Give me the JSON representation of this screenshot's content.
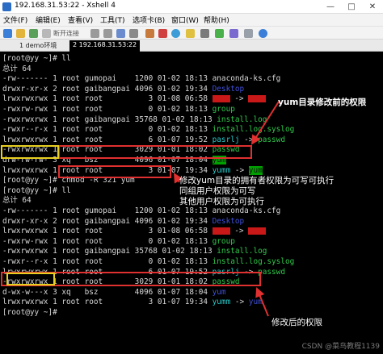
{
  "window": {
    "title": "192.168.31.53:22 - Xshell 4",
    "controls": [
      "—",
      "□",
      "✕"
    ]
  },
  "menu": [
    "文件(F)",
    "编辑(E)",
    "查看(V)",
    "工具(T)",
    "选项卡(B)",
    "窗口(W)",
    "帮助(H)"
  ],
  "toolbar": {
    "disconnect_label": "断开连接",
    "icons": [
      "new-session-icon",
      "open-folder-icon",
      "reconnect-icon",
      "disconnect-icon",
      "copy-icon",
      "paste-icon",
      "find-icon",
      "print-icon",
      "font-icon",
      "color-icon",
      "globe-icon",
      "lock-icon",
      "keyboard-icon",
      "transfer-icon",
      "script-icon",
      "fullscreen-icon",
      "help-icon"
    ]
  },
  "tabs": [
    {
      "label": "1 demo环境",
      "active": false
    },
    {
      "label": "2 192.168.31.53:22",
      "active": true
    }
  ],
  "terminal": {
    "lines": [
      {
        "segs": [
          {
            "t": "[root@yy ~]# ll"
          }
        ]
      },
      {
        "segs": [
          {
            "t": "总计 64"
          }
        ]
      },
      {
        "segs": [
          {
            "t": "-rw------- 1 root gumopai    1200 01-02 18:13 anaconda-ks.cfg"
          }
        ]
      },
      {
        "segs": [
          {
            "t": "drwxr-xr-x 2 root gaibangpai 4096 01-02 19:34 "
          },
          {
            "t": "Desktop",
            "c": "blue"
          }
        ]
      },
      {
        "segs": [
          {
            "t": "lrwxrwxrwx 1 root root          3 01-08 06:58 "
          },
          {
            "red": true
          },
          {
            "t": " -> "
          },
          {
            "red": true
          }
        ]
      },
      {
        "segs": [
          {
            "t": "-rwxrw-rwx 1 root root          0 01-02 18:13 "
          },
          {
            "t": "group",
            "c": "green"
          }
        ]
      },
      {
        "segs": [
          {
            "t": "-rwxrwxrwx 1 root gaibangpai 35768 01-02 18:13 "
          },
          {
            "t": "install.log",
            "c": "green"
          }
        ]
      },
      {
        "segs": [
          {
            "t": "-rwxr--r-x 1 root root          0 01-02 18:13 "
          },
          {
            "t": "install.log.syslog",
            "c": "green"
          }
        ]
      },
      {
        "segs": [
          {
            "t": "lrwxrwxrwx 1 root root          6 01-07 19:52 "
          },
          {
            "t": "pasrlj",
            "c": "cyan"
          },
          {
            "t": " -> "
          },
          {
            "t": "passwd",
            "c": "green"
          }
        ]
      },
      {
        "segs": [
          {
            "t": "-rwxrwxrwx 1 root root       3029 01-01 18:02 "
          },
          {
            "t": "passwd",
            "c": "green"
          }
        ]
      },
      {
        "segs": [
          {
            "t": "drw-rw-rw- 3 xq   bsz        4096 01-07 18:04 "
          },
          {
            "t": "yum",
            "c": "hlgreen"
          }
        ]
      },
      {
        "segs": [
          {
            "t": "lrwxrwxrwx 1 root root          3 01-07 19:34 "
          },
          {
            "t": "yumm",
            "c": "cyan"
          },
          {
            "t": " -> "
          },
          {
            "t": "yum",
            "c": "hlgreen"
          }
        ]
      },
      {
        "segs": [
          {
            "t": "[root@yy ~]# chmod -R 321 yum"
          }
        ]
      },
      {
        "segs": [
          {
            "t": "[root@yy ~]# ll"
          }
        ]
      },
      {
        "segs": [
          {
            "t": "总计 64"
          }
        ]
      },
      {
        "segs": [
          {
            "t": "-rw------- 1 root gumopai    1200 01-02 18:13 anaconda-ks.cfg"
          }
        ]
      },
      {
        "segs": [
          {
            "t": "drwxr-xr-x 2 root gaibangpai 4096 01-02 19:34 "
          },
          {
            "t": "Desktop",
            "c": "blue"
          }
        ]
      },
      {
        "segs": [
          {
            "t": "lrwxrwxrwx 1 root root          3 01-08 06:58 "
          },
          {
            "red": true
          },
          {
            "t": " -> "
          },
          {
            "red": true
          }
        ]
      },
      {
        "segs": [
          {
            "t": "-rwxrw-rwx 1 root root          0 01-02 18:13 "
          },
          {
            "t": "group",
            "c": "green"
          }
        ]
      },
      {
        "segs": [
          {
            "t": "-rwxrwxrwx 1 root gaibangpai 35768 01-02 18:13 "
          },
          {
            "t": "install.log",
            "c": "green"
          }
        ]
      },
      {
        "segs": [
          {
            "t": "-rwxr--r-x 1 root root          0 01-02 18:13 "
          },
          {
            "t": "install.log.syslog",
            "c": "green"
          }
        ]
      },
      {
        "segs": [
          {
            "t": "lrwxrwxrwx 1 root root          6 01-07 19:52 "
          },
          {
            "t": "pasrlj",
            "c": "cyan"
          },
          {
            "t": " -> "
          },
          {
            "t": "passwd",
            "c": "green"
          }
        ]
      },
      {
        "segs": [
          {
            "t": "-rwxrwxrwx 1 root root       3029 01-01 18:02 "
          },
          {
            "t": "passwd",
            "c": "green"
          }
        ]
      },
      {
        "segs": [
          {
            "t": "d-wx-w---x 3 xq   bsz        4096 01-07 18:04 "
          },
          {
            "t": "yum",
            "c": "blue"
          }
        ]
      },
      {
        "segs": [
          {
            "t": "lrwxrwxrwx 1 root root          3 01-07 19:34 "
          },
          {
            "t": "yumm",
            "c": "cyan"
          },
          {
            "t": " -> "
          },
          {
            "t": "yum",
            "c": "blue"
          }
        ]
      },
      {
        "segs": [
          {
            "t": "[root@yy ~]# "
          }
        ]
      }
    ]
  },
  "annotations": {
    "before": "yum目录修改前的权限",
    "change_1": "修改yum目录的拥有者权限为可写可执行",
    "change_2": "同组用户权限为可写",
    "change_3": "其他用户权限为可执行",
    "after": "修改后的权限"
  },
  "watermark": "CSDN @菜鸟教程1139",
  "colors": {
    "terminal_bg": "#000000",
    "text": "#d8d8d8",
    "dir_blue": "#4050d8",
    "exec_green": "#2ec84a",
    "link_cyan": "#2ac8c8",
    "annotation_red": "#e03030",
    "annotation_purple": "#8a2be2",
    "highlight_yellow": "#e8d020"
  }
}
